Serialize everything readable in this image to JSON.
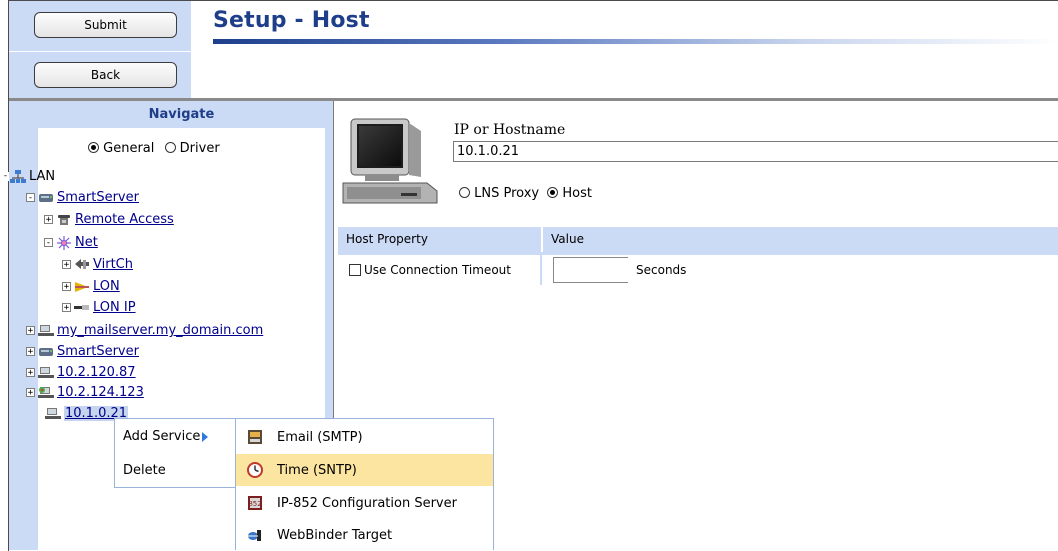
{
  "buttons": {
    "submit": "Submit",
    "back": "Back"
  },
  "page_title": "Setup - Host",
  "navigate": {
    "header": "Navigate",
    "modes": [
      {
        "label": "General",
        "selected": true
      },
      {
        "label": "Driver",
        "selected": false
      }
    ]
  },
  "tree": {
    "lan": "LAN",
    "smartserver": "SmartServer",
    "remote_access": "Remote Access",
    "net": "Net",
    "virtch": "VirtCh",
    "lon": "LON",
    "lon_ip": "LON IP",
    "mailserver": "my_mailserver.my_domain.com",
    "smartserver2": "SmartServer",
    "host1": "10.2.120.87",
    "host2": "10.2.124.123",
    "host3": "10.1.0.21"
  },
  "form": {
    "ip_label": "IP or Hostname",
    "ip_value": "10.1.0.21",
    "proxy_options": [
      {
        "label": "LNS Proxy",
        "selected": false
      },
      {
        "label": "Host",
        "selected": true
      }
    ],
    "table_headers": {
      "property": "Host Property",
      "value": "Value"
    },
    "timeout_label": "Use Connection Timeout",
    "timeout_value": "",
    "seconds_label": "Seconds"
  },
  "context_menu": {
    "add_service": "Add Service",
    "delete": "Delete",
    "submenu": [
      {
        "label": "Email (SMTP)",
        "icon": "email-icon",
        "highlighted": false
      },
      {
        "label": "Time (SNTP)",
        "icon": "clock-icon",
        "highlighted": true
      },
      {
        "label": "IP-852 Configuration Server",
        "icon": "config-server-icon",
        "highlighted": false
      },
      {
        "label": "WebBinder Target",
        "icon": "webbinder-icon",
        "highlighted": false
      }
    ]
  }
}
